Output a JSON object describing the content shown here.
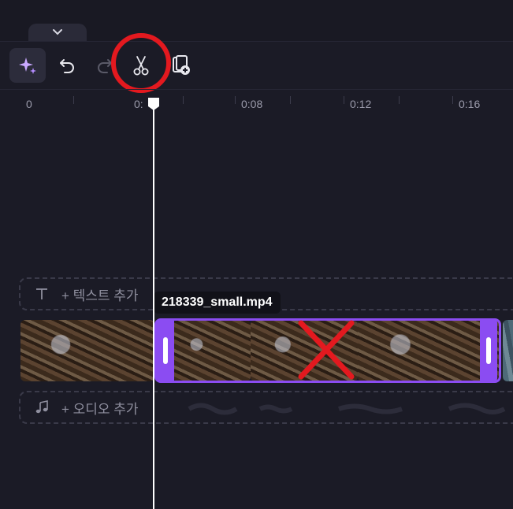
{
  "toolbar": {
    "buttons": [
      {
        "name": "magic-sparkle-icon",
        "active": true
      },
      {
        "name": "undo-icon"
      },
      {
        "name": "redo-icon"
      },
      {
        "name": "scissors-icon"
      },
      {
        "name": "add-clip-icon"
      }
    ]
  },
  "ruler": {
    "labels": [
      "0",
      "0:",
      "0:08",
      "0:12",
      "0:16"
    ]
  },
  "tracks": {
    "text_track_label": "+ 텍스트 추가",
    "audio_track_label": "+ 오디오 추가"
  },
  "clip": {
    "tooltip": "218339_small.mp4"
  },
  "colors": {
    "accent": "#8b4cf2",
    "annotation_red": "#e3191f",
    "background": "#1b1b26"
  }
}
